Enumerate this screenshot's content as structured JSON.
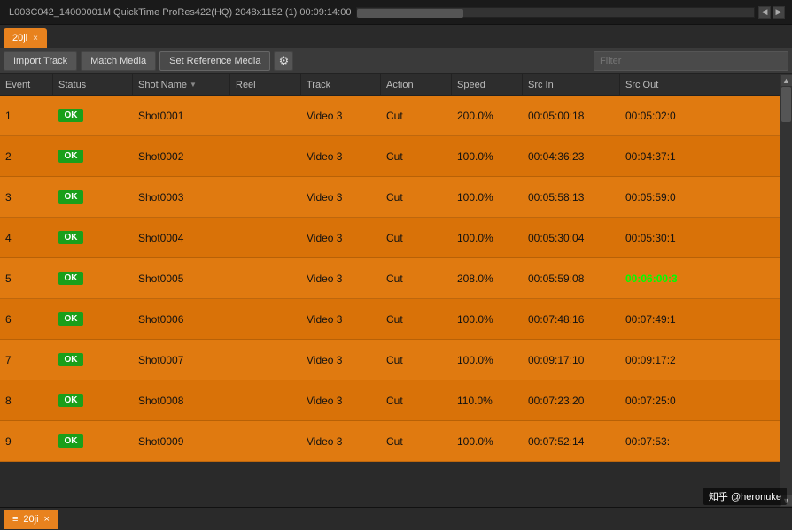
{
  "topbar": {
    "media_label": "L003C042_14000001M     QuickTime ProRes422(HQ)     2048x1152 (1)     00:09:14:00"
  },
  "tab": {
    "label": "20ji",
    "close": "×"
  },
  "toolbar": {
    "import_track": "Import Track",
    "match_media": "Match Media",
    "set_reference_media": "Set Reference Media",
    "filter_placeholder": "Filter"
  },
  "columns": [
    {
      "key": "event",
      "label": "Event"
    },
    {
      "key": "status",
      "label": "Status"
    },
    {
      "key": "shot",
      "label": "Shot Name",
      "sort": true
    },
    {
      "key": "reel",
      "label": "Reel"
    },
    {
      "key": "track",
      "label": "Track"
    },
    {
      "key": "action",
      "label": "Action"
    },
    {
      "key": "speed",
      "label": "Speed"
    },
    {
      "key": "srcin",
      "label": "Src In"
    },
    {
      "key": "srcout",
      "label": "Src Out"
    }
  ],
  "rows": [
    {
      "event": "1",
      "status": "OK",
      "shot": "Shot0001",
      "reel": "",
      "track": "Video 3",
      "action": "Cut",
      "speed": "200.0%",
      "srcin": "00:05:00:18",
      "srcout": "00:05:02:0",
      "highlight": false
    },
    {
      "event": "2",
      "status": "OK",
      "shot": "Shot0002",
      "reel": "",
      "track": "Video 3",
      "action": "Cut",
      "speed": "100.0%",
      "srcin": "00:04:36:23",
      "srcout": "00:04:37:1",
      "highlight": false
    },
    {
      "event": "3",
      "status": "OK",
      "shot": "Shot0003",
      "reel": "",
      "track": "Video 3",
      "action": "Cut",
      "speed": "100.0%",
      "srcin": "00:05:58:13",
      "srcout": "00:05:59:0",
      "highlight": false
    },
    {
      "event": "4",
      "status": "OK",
      "shot": "Shot0004",
      "reel": "",
      "track": "Video 3",
      "action": "Cut",
      "speed": "100.0%",
      "srcin": "00:05:30:04",
      "srcout": "00:05:30:1",
      "highlight": false
    },
    {
      "event": "5",
      "status": "OK",
      "shot": "Shot0005",
      "reel": "",
      "track": "Video 3",
      "action": "Cut",
      "speed": "208.0%",
      "srcin": "00:05:59:08",
      "srcout": "00:06:00:3",
      "highlight": true
    },
    {
      "event": "6",
      "status": "OK",
      "shot": "Shot0006",
      "reel": "",
      "track": "Video 3",
      "action": "Cut",
      "speed": "100.0%",
      "srcin": "00:07:48:16",
      "srcout": "00:07:49:1",
      "highlight": false
    },
    {
      "event": "7",
      "status": "OK",
      "shot": "Shot0007",
      "reel": "",
      "track": "Video 3",
      "action": "Cut",
      "speed": "100.0%",
      "srcin": "00:09:17:10",
      "srcout": "00:09:17:2",
      "highlight": false
    },
    {
      "event": "8",
      "status": "OK",
      "shot": "Shot0008",
      "reel": "",
      "track": "Video 3",
      "action": "Cut",
      "speed": "110.0%",
      "srcin": "00:07:23:20",
      "srcout": "00:07:25:0",
      "highlight": false
    },
    {
      "event": "9",
      "status": "OK",
      "shot": "Shot0009",
      "reel": "",
      "track": "Video 3",
      "action": "Cut",
      "speed": "100.0%",
      "srcin": "00:07:52:14",
      "srcout": "00:07:53:",
      "highlight": false
    }
  ],
  "bottom_tab": {
    "label": "20ji",
    "close": "×"
  },
  "watermark": "知乎 @heronuke"
}
